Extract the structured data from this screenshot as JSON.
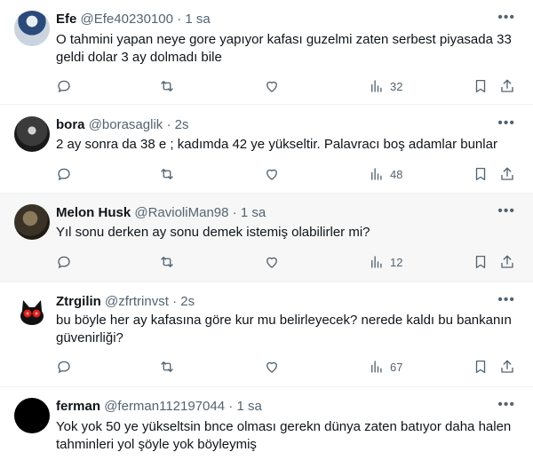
{
  "tweets": [
    {
      "name": "Efe",
      "handle": "@Efe40230100",
      "sep": "·",
      "time": "1 sa",
      "text": "O tahmini yapan neye gore yapıyor kafası guzelmi zaten serbest piyasada 33 geldi dolar 3 ay dolmadı bile",
      "views": "32"
    },
    {
      "name": "bora",
      "handle": "@borasaglik",
      "sep": "·",
      "time": "2s",
      "text": "2 ay sonra da 38 e ; kadımda 42 ye yükseltir. Palavracı boş adamlar bunlar",
      "views": "48"
    },
    {
      "name": "Melon Husk",
      "handle": "@RavioliMan98",
      "sep": "·",
      "time": "1 sa",
      "text": "Yıl sonu derken ay sonu demek istemiş olabilirler mi?",
      "views": "12"
    },
    {
      "name": "Ztrgilin",
      "handle": "@zfrtrinvst",
      "sep": "·",
      "time": "2s",
      "text": "bu böyle her ay kafasına göre kur mu belirleyecek? nerede kaldı bu bankanın güvenirliği?",
      "views": "67"
    },
    {
      "name": "ferman",
      "handle": "@ferman112197044",
      "sep": "·",
      "time": "1 sa",
      "text": "Yok yok 50 ye yükseltsin bnce olması gerekn dünya zaten batıyor daha halen tahminleri yol şöyle yok böyleymiş",
      "views": ""
    }
  ],
  "icons": {
    "more": "more-icon",
    "reply": "reply-icon",
    "retweet": "retweet-icon",
    "like": "like-icon",
    "views": "views-icon",
    "bookmark": "bookmark-icon",
    "share": "share-icon"
  },
  "colors": {
    "text": "#0f1419",
    "muted": "#536471",
    "highlight_bg": "#f7f7f7",
    "divider": "#eff3f4"
  }
}
